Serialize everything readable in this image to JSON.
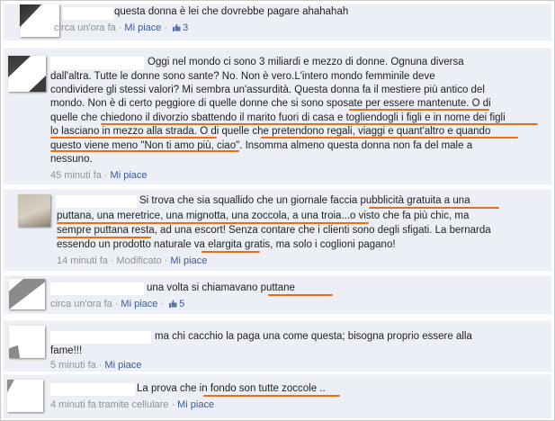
{
  "comments": [
    {
      "text": "questa donna è lei che dovrebbe pagare ahahahah",
      "time": "circa un'ora fa",
      "like_label": "Mi piace",
      "like_count": "3"
    },
    {
      "lines": [
        "Oggi nel mondo ci sono 3 miliardi e mezzo di donne. Ognuna diversa",
        "dall'altra. Tutte le donne sono sante? No. Non è vero.L'intero mondo femminile deve",
        "condividere gli stessi valori? Mi sembra un'assurdità. Questa donna fa il mestiere più antico del",
        "mondo. Non è di certo peggiore di quelle donne che si sono sposate per essere mantenute. O di",
        "quelle che chiedono il divorzio sbattendo il marito fuori di casa e togliendogli i figli e in nome dei figli",
        "lo lasciano in mezzo alla strada. O di quelle che pretendono regali, viaggi e quant'altro e quando",
        "questo viene meno \"Non ti amo più, ciao\". Insomma almeno questa donna non fa del male a",
        "nessuno."
      ],
      "time": "45 minuti fa",
      "like_label": "Mi piace"
    },
    {
      "lines": [
        "Si trova che sia squallido che un giornale faccia pubblicità gratuita a una",
        "puttana, una meretrice, una mignotta, una zoccola, a una troia...o visto che fa più chic, ma",
        "sempre puttana resta, ad una escort! Senza contare che i clienti sono degli sfigati. La bernarda",
        "essendo un prodotto naturale va elargita gratis, ma solo i coglioni pagano!"
      ],
      "time": "14 minuti fa",
      "modified": "Modificato",
      "like_label": "Mi piace"
    },
    {
      "text": "una volta si chiamavano puttane",
      "time": "circa un'ora fa",
      "like_label": "Mi piace",
      "like_count": "5"
    },
    {
      "lines": [
        "ma chi cacchio la paga una come questa; bisogna proprio essere alla",
        "fame!!!"
      ],
      "time": "5 minuti fa",
      "like_label": "Mi piace"
    },
    {
      "text": "La prova che in fondo son tutte zoccole ..",
      "time": "4 minuti fa tramite cellulare",
      "like_label": "Mi piace"
    }
  ],
  "icons": {
    "like": "thumbs-up-icon"
  },
  "colors": {
    "background": "#eceff5",
    "link": "#3b5998",
    "meta": "#8f9296",
    "underline": "#e8701b"
  }
}
